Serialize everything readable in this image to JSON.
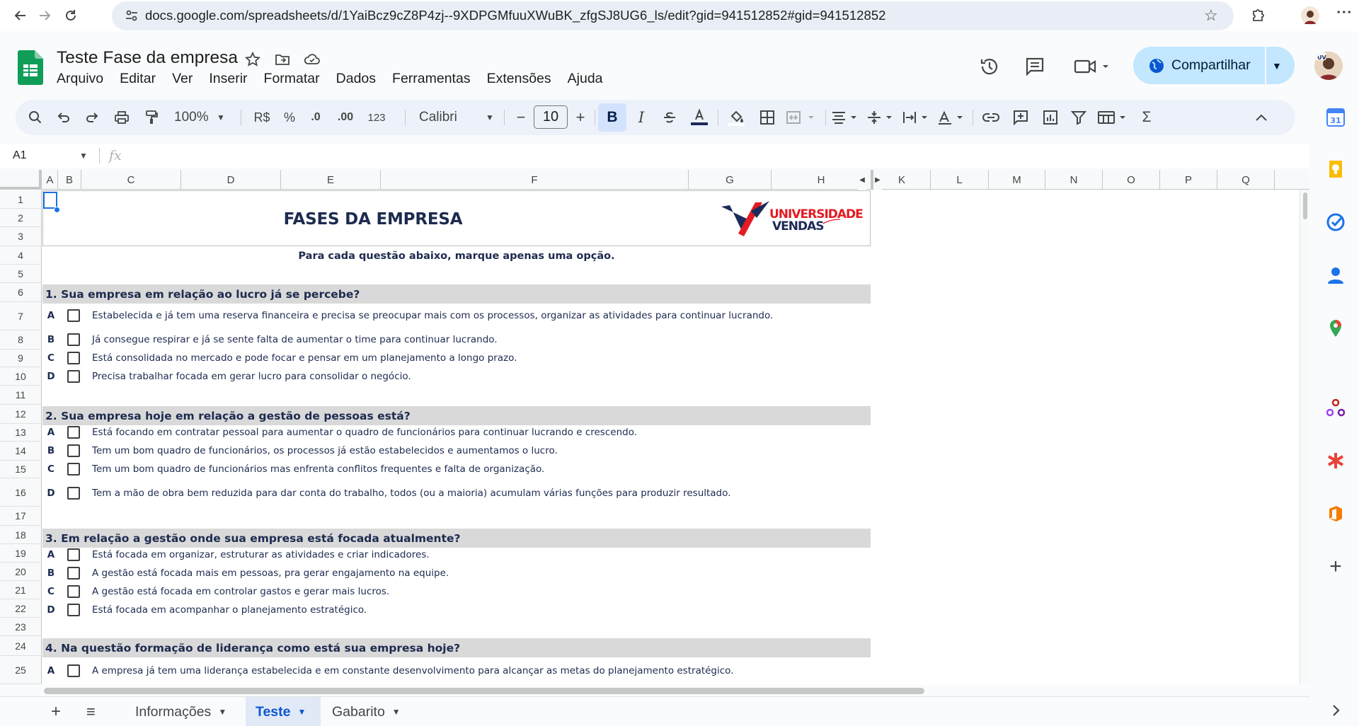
{
  "browser": {
    "url": "docs.google.com/spreadsheets/d/1YaiBcz9cZ8P4zj--9XDPGMfuuXWuBK_zfgSJ8UG6_ls/edit?gid=941512852#gid=941512852"
  },
  "doc": {
    "title": "Teste Fase da empresa",
    "menu": [
      "Arquivo",
      "Editar",
      "Ver",
      "Inserir",
      "Formatar",
      "Dados",
      "Ferramentas",
      "Extensões",
      "Ajuda"
    ],
    "share_label": "Compartilhar"
  },
  "toolbar": {
    "zoom": "100%",
    "currency": "R$",
    "percent": "%",
    "dec_decrease": ".0",
    "dec_increase": ".00",
    "format_more": "123",
    "font": "Calibri",
    "font_size": "10",
    "bold": "B",
    "italic": "I"
  },
  "formula_bar": {
    "cell_ref": "A1",
    "fx": "fx"
  },
  "grid": {
    "columns": [
      "A",
      "B",
      "C",
      "D",
      "E",
      "F",
      "G",
      "H",
      "K",
      "L",
      "M",
      "N",
      "O",
      "P",
      "Q"
    ],
    "rows": [
      "1",
      "2",
      "3",
      "4",
      "5",
      "6",
      "7",
      "8",
      "9",
      "10",
      "11",
      "12",
      "13",
      "14",
      "15",
      "16",
      "17",
      "18",
      "19",
      "20",
      "21",
      "22",
      "23",
      "24",
      "25"
    ]
  },
  "sheet": {
    "title": "FASES DA EMPRESA",
    "logo_text": [
      "UNIVERSIDADE",
      "VENDAS"
    ],
    "instruction": "Para cada questão abaixo, marque apenas uma opção.",
    "questions": [
      {
        "heading": "1. Sua empresa em relação ao lucro já se percebe?",
        "options": [
          {
            "letter": "A",
            "text": "Estabelecida e já tem uma reserva financeira e precisa se preocupar mais com os processos, organizar as atividades para continuar lucrando."
          },
          {
            "letter": "B",
            "text": "Já consegue respirar e já se sente falta de aumentar o time para continuar lucrando."
          },
          {
            "letter": "C",
            "text": "Está consolidada no mercado e pode focar e pensar em um planejamento a longo prazo."
          },
          {
            "letter": "D",
            "text": "Precisa trabalhar focada em gerar lucro para consolidar o negócio."
          }
        ]
      },
      {
        "heading": "2. Sua empresa hoje em relação a gestão de pessoas está?",
        "options": [
          {
            "letter": "A",
            "text": "Está focando em contratar pessoal para aumentar o quadro de funcionários para continuar lucrando e crescendo."
          },
          {
            "letter": "B",
            "text": "Tem um bom quadro de funcionários, os processos já estão estabelecidos e aumentamos o lucro."
          },
          {
            "letter": "C",
            "text": "Tem um bom quadro de funcionários mas enfrenta conflitos frequentes e falta de organização."
          },
          {
            "letter": "D",
            "text": "Tem a mão de obra bem reduzida para dar conta do trabalho, todos (ou a maioria) acumulam várias funções para produzir resultado."
          }
        ]
      },
      {
        "heading": "3. Em relação a gestão onde sua empresa está focada atualmente?",
        "options": [
          {
            "letter": "A",
            "text": "Está focada em organizar, estruturar as atividades e criar indicadores."
          },
          {
            "letter": "B",
            "text": "A gestão está focada mais em pessoas, pra gerar engajamento na equipe."
          },
          {
            "letter": "C",
            "text": "A gestão está focada em controlar gastos e gerar mais lucros."
          },
          {
            "letter": "D",
            "text": "Está focada em acompanhar o planejamento estratégico."
          }
        ]
      },
      {
        "heading": "4. Na questão formação de liderança como está sua empresa hoje?",
        "options": [
          {
            "letter": "A",
            "text": "A empresa já tem uma liderança estabelecida e em constante desenvolvimento para alcançar as metas do planejamento estratégico."
          }
        ]
      }
    ]
  },
  "tabs": {
    "add": "+",
    "list": "≡",
    "items": [
      {
        "label": "Informações",
        "active": false
      },
      {
        "label": "Teste",
        "active": true
      },
      {
        "label": "Gabarito",
        "active": false
      }
    ]
  },
  "side_panel": {
    "calendar_day": "31",
    "icons": [
      "calendar-icon",
      "keep-icon",
      "tasks-icon",
      "contacts-icon",
      "maps-icon",
      "webhook-icon",
      "asterisk-addon-icon",
      "office-addon-icon",
      "add-addon-icon"
    ]
  },
  "colors": {
    "accent": "#0b57d0",
    "share_bg": "#c2e7ff",
    "header_fill": "#d9d9d9",
    "text_navy": "#1d2b4f",
    "logo_red": "#e31b23",
    "logo_navy": "#1d2b5a"
  }
}
